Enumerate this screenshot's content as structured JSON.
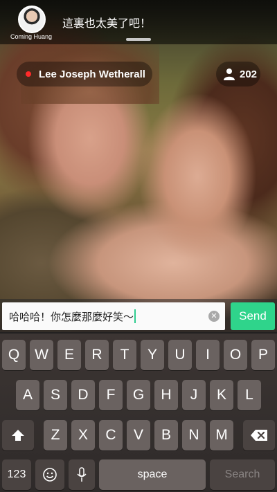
{
  "top_bar": {
    "user_name": "Coming Huang",
    "comment": "這裏也太美了吧！"
  },
  "stream": {
    "host_name": "Lee Joseph Wetherall",
    "viewer_count": "202"
  },
  "chat": {
    "input_value": "哈哈哈！你怎麼那麼好笑～",
    "clear_label": "✕",
    "send_label": "Send"
  },
  "keyboard": {
    "row1": [
      "Q",
      "W",
      "E",
      "R",
      "T",
      "Y",
      "U",
      "I",
      "O",
      "P"
    ],
    "row2": [
      "A",
      "S",
      "D",
      "F",
      "G",
      "H",
      "J",
      "K",
      "L"
    ],
    "row3": [
      "Z",
      "X",
      "C",
      "V",
      "B",
      "N",
      "M"
    ],
    "numbers_label": "123",
    "space_label": "space",
    "search_label": "Search"
  },
  "colors": {
    "send_green": "#2fd48b",
    "live_red": "#ff2a2a"
  }
}
